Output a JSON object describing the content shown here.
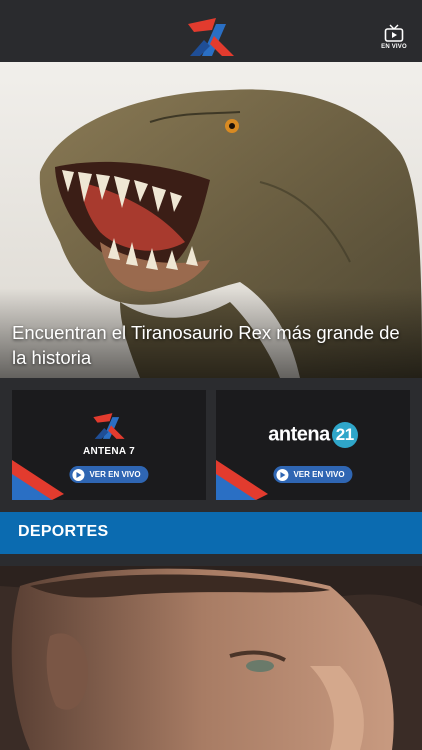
{
  "header": {
    "logo_icon": "antena7-logo-icon",
    "live_label": "EN VIVO",
    "live_icon": "tv-play-icon"
  },
  "hero": {
    "title": "Encuentran el Tiranosaurio Rex más grande de la historia",
    "image": "t-rex-head-photo"
  },
  "channels": [
    {
      "name": "ANTENA 7",
      "button_label": "VER EN VIVO"
    },
    {
      "name_prefix": "antena",
      "name_badge": "21",
      "button_label": "VER EN VIVO"
    }
  ],
  "section": {
    "title": "DEPORTES"
  },
  "article_photo": "football-player-portrait",
  "colors": {
    "topbar": "#2a2b2e",
    "section_bar": "#0b6bb0",
    "live_button": "#2f66b3",
    "brand_red": "#e23b2e",
    "brand_blue": "#2a6fc4"
  }
}
